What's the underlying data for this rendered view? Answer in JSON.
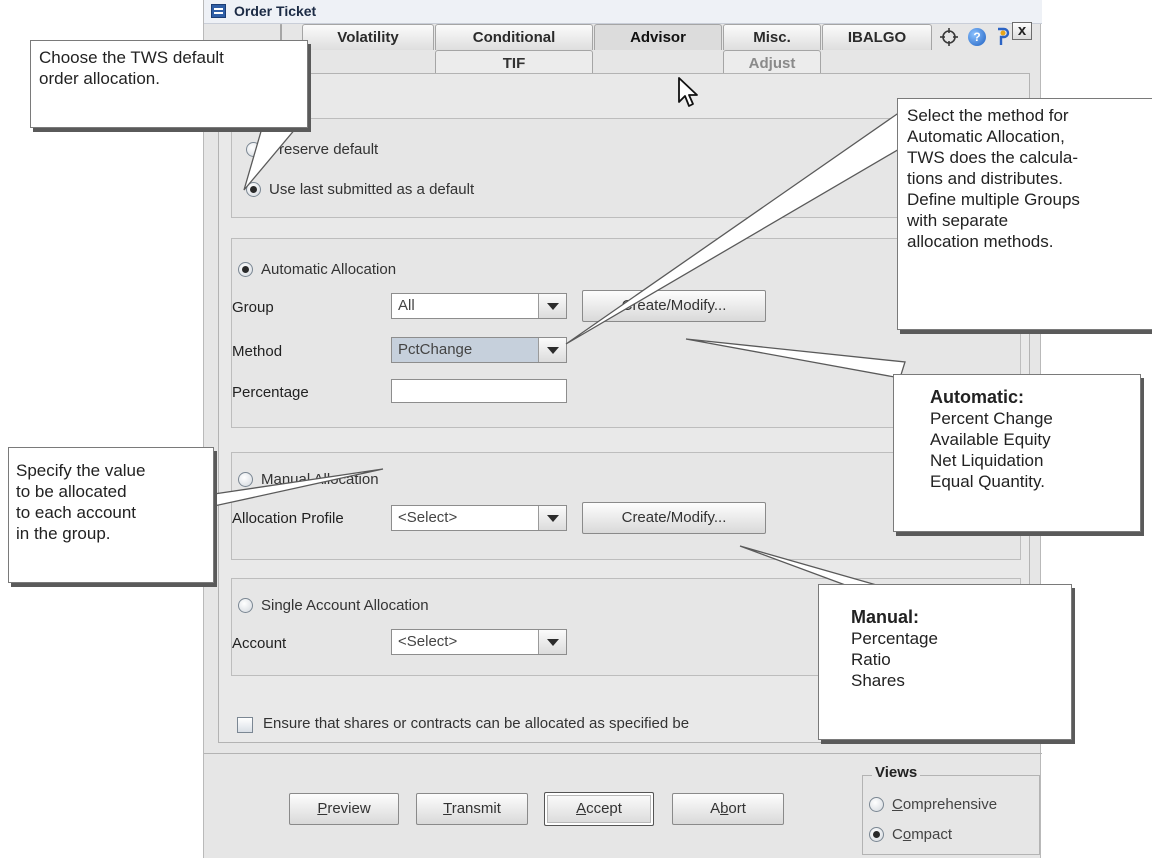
{
  "window": {
    "title": "Order Ticket",
    "close_label": "x"
  },
  "tabs": {
    "top": [
      "Volatility",
      "Conditional",
      "Advisor",
      "Misc.",
      "IBALGO"
    ],
    "sub": [
      "TIF",
      "Adjust"
    ],
    "active": "Advisor"
  },
  "toolbar_icons": [
    "crosshair-icon",
    "help-icon",
    "pin-icon"
  ],
  "default_section": {
    "preserve_label": "Preserve default",
    "last_submitted_label": "Use last submitted as a default"
  },
  "automatic": {
    "radio_label": "Automatic Allocation",
    "group_label": "Group",
    "group_value": "All",
    "create_modify_label": "Create/Modify...",
    "method_label": "Method",
    "method_value": "PctChange",
    "percentage_label": "Percentage",
    "percentage_value": ""
  },
  "manual": {
    "radio_label": "Manual Allocation",
    "profile_label": "Allocation Profile",
    "profile_value": "<Select>",
    "create_modify_label": "Create/Modify..."
  },
  "single": {
    "radio_label": "Single Account Allocation",
    "account_label": "Account",
    "account_value": "<Select>"
  },
  "ensure_label": "Ensure that shares or contracts can be allocated as specified be",
  "buttons": {
    "preview": {
      "first": "P",
      "rest": "review"
    },
    "transmit": {
      "first": "T",
      "rest": "ransmit"
    },
    "accept": {
      "first": "A",
      "rest": "ccept"
    },
    "abort": {
      "pre": "A",
      "u": "b",
      "post": "ort"
    }
  },
  "views": {
    "title": "Views",
    "comprehensive": {
      "u": "C",
      "rest": "omprehensive"
    },
    "compact": {
      "pre": "C",
      "u": "o",
      "post": "mpact"
    }
  },
  "callouts": {
    "tws_default": [
      "Choose the TWS default",
      "order allocation."
    ],
    "method": [
      "Select the method for",
      "Automatic Allocation,",
      "TWS does the calcula-",
      "tions and distributes.",
      "Define multiple Groups",
      "with separate",
      "allocation methods."
    ],
    "specify": [
      "Specify the value",
      "to be allocated",
      "to each account",
      "in the group."
    ],
    "automatic_title": "Automatic:",
    "automatic_items": [
      "Percent Change",
      "Available Equity",
      "Net Liquidation",
      "Equal Quantity."
    ],
    "manual_title": "Manual:",
    "manual_items": [
      "Percentage",
      "Ratio",
      "Shares"
    ]
  }
}
